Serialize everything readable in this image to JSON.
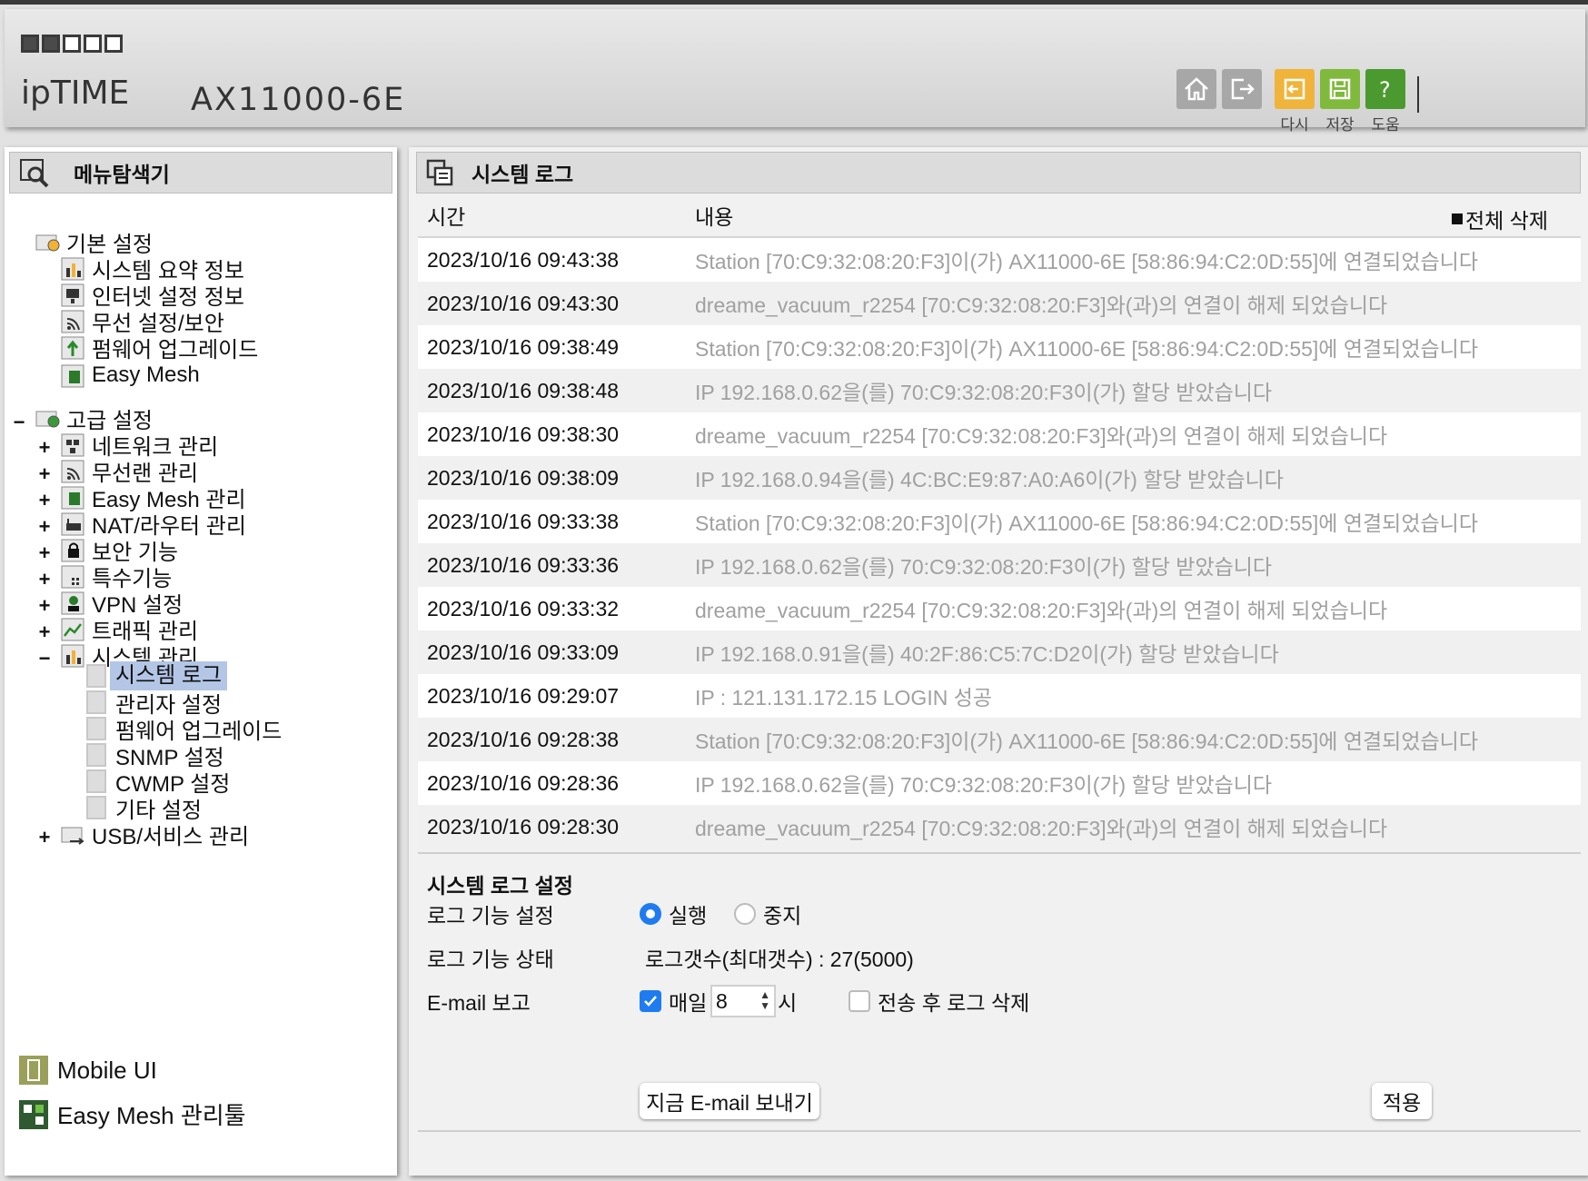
{
  "header": {
    "logo_text": "ipTIME",
    "model": "AX11000-6E",
    "buttons": {
      "reload_label": "다시",
      "save_label": "저장",
      "help_label": "도움"
    }
  },
  "sidebar": {
    "title": "메뉴탐색기",
    "basic_group": "기본 설정",
    "basic_items": [
      "시스템 요약 정보",
      "인터넷 설정 정보",
      "무선 설정/보안",
      "펌웨어 업그레이드",
      "Easy Mesh"
    ],
    "advanced_group": "고급 설정",
    "advanced_items": [
      "네트워크 관리",
      "무선랜 관리",
      "Easy Mesh 관리",
      "NAT/라우터 관리",
      "보안 기능",
      "특수기능",
      "VPN 설정",
      "트래픽 관리",
      "시스템 관리"
    ],
    "system_subitems": [
      "시스템 로그",
      "관리자 설정",
      "펌웨어 업그레이드",
      "SNMP 설정",
      "CWMP 설정",
      "기타 설정"
    ],
    "usb_item": "USB/서비스 관리",
    "mobile_ui": "Mobile UI",
    "easymesh_tool": "Easy Mesh 관리툴"
  },
  "main": {
    "title": "시스템 로그",
    "col_time": "시간",
    "col_content": "내용",
    "delete_all": "전체 삭제",
    "logs": [
      {
        "time": "2023/10/16 09:43:38",
        "content": "Station [70:C9:32:08:20:F3]이(가) AX11000-6E [58:86:94:C2:0D:55]에 연결되었습니다"
      },
      {
        "time": "2023/10/16 09:43:30",
        "content": "dreame_vacuum_r2254 [70:C9:32:08:20:F3]와(과)의 연결이 해제 되었습니다"
      },
      {
        "time": "2023/10/16 09:38:49",
        "content": "Station [70:C9:32:08:20:F3]이(가) AX11000-6E [58:86:94:C2:0D:55]에 연결되었습니다"
      },
      {
        "time": "2023/10/16 09:38:48",
        "content": "IP 192.168.0.62을(를) 70:C9:32:08:20:F3이(가) 할당 받았습니다"
      },
      {
        "time": "2023/10/16 09:38:30",
        "content": "dreame_vacuum_r2254 [70:C9:32:08:20:F3]와(과)의 연결이 해제 되었습니다"
      },
      {
        "time": "2023/10/16 09:38:09",
        "content": "IP 192.168.0.94을(를) 4C:BC:E9:87:A0:A6이(가) 할당 받았습니다"
      },
      {
        "time": "2023/10/16 09:33:38",
        "content": "Station [70:C9:32:08:20:F3]이(가) AX11000-6E [58:86:94:C2:0D:55]에 연결되었습니다"
      },
      {
        "time": "2023/10/16 09:33:36",
        "content": "IP 192.168.0.62을(를) 70:C9:32:08:20:F3이(가) 할당 받았습니다"
      },
      {
        "time": "2023/10/16 09:33:32",
        "content": "dreame_vacuum_r2254 [70:C9:32:08:20:F3]와(과)의 연결이 해제 되었습니다"
      },
      {
        "time": "2023/10/16 09:33:09",
        "content": "IP 192.168.0.91을(를) 40:2F:86:C5:7C:D2이(가) 할당 받았습니다"
      },
      {
        "time": "2023/10/16 09:29:07",
        "content": "IP : 121.131.172.15 LOGIN 성공"
      },
      {
        "time": "2023/10/16 09:28:38",
        "content": "Station [70:C9:32:08:20:F3]이(가) AX11000-6E [58:86:94:C2:0D:55]에 연결되었습니다"
      },
      {
        "time": "2023/10/16 09:28:36",
        "content": "IP 192.168.0.62을(를) 70:C9:32:08:20:F3이(가) 할당 받았습니다"
      },
      {
        "time": "2023/10/16 09:28:30",
        "content": "dreame_vacuum_r2254 [70:C9:32:08:20:F3]와(과)의 연결이 해제 되었습니다"
      }
    ],
    "settings": {
      "title": "시스템 로그 설정",
      "log_function_label": "로그 기능 설정",
      "run_label": "실행",
      "stop_label": "중지",
      "log_status_label": "로그 기능 상태",
      "log_status_value": "로그갯수(최대갯수) : 27(5000)",
      "email_label": "E-mail 보고",
      "daily_label": "매일",
      "hour_value": "8",
      "hour_unit": "시",
      "delete_after_send_label": "전송 후 로그 삭제",
      "send_now_label": "지금 E-mail 보내기",
      "apply_label": "적용"
    }
  }
}
